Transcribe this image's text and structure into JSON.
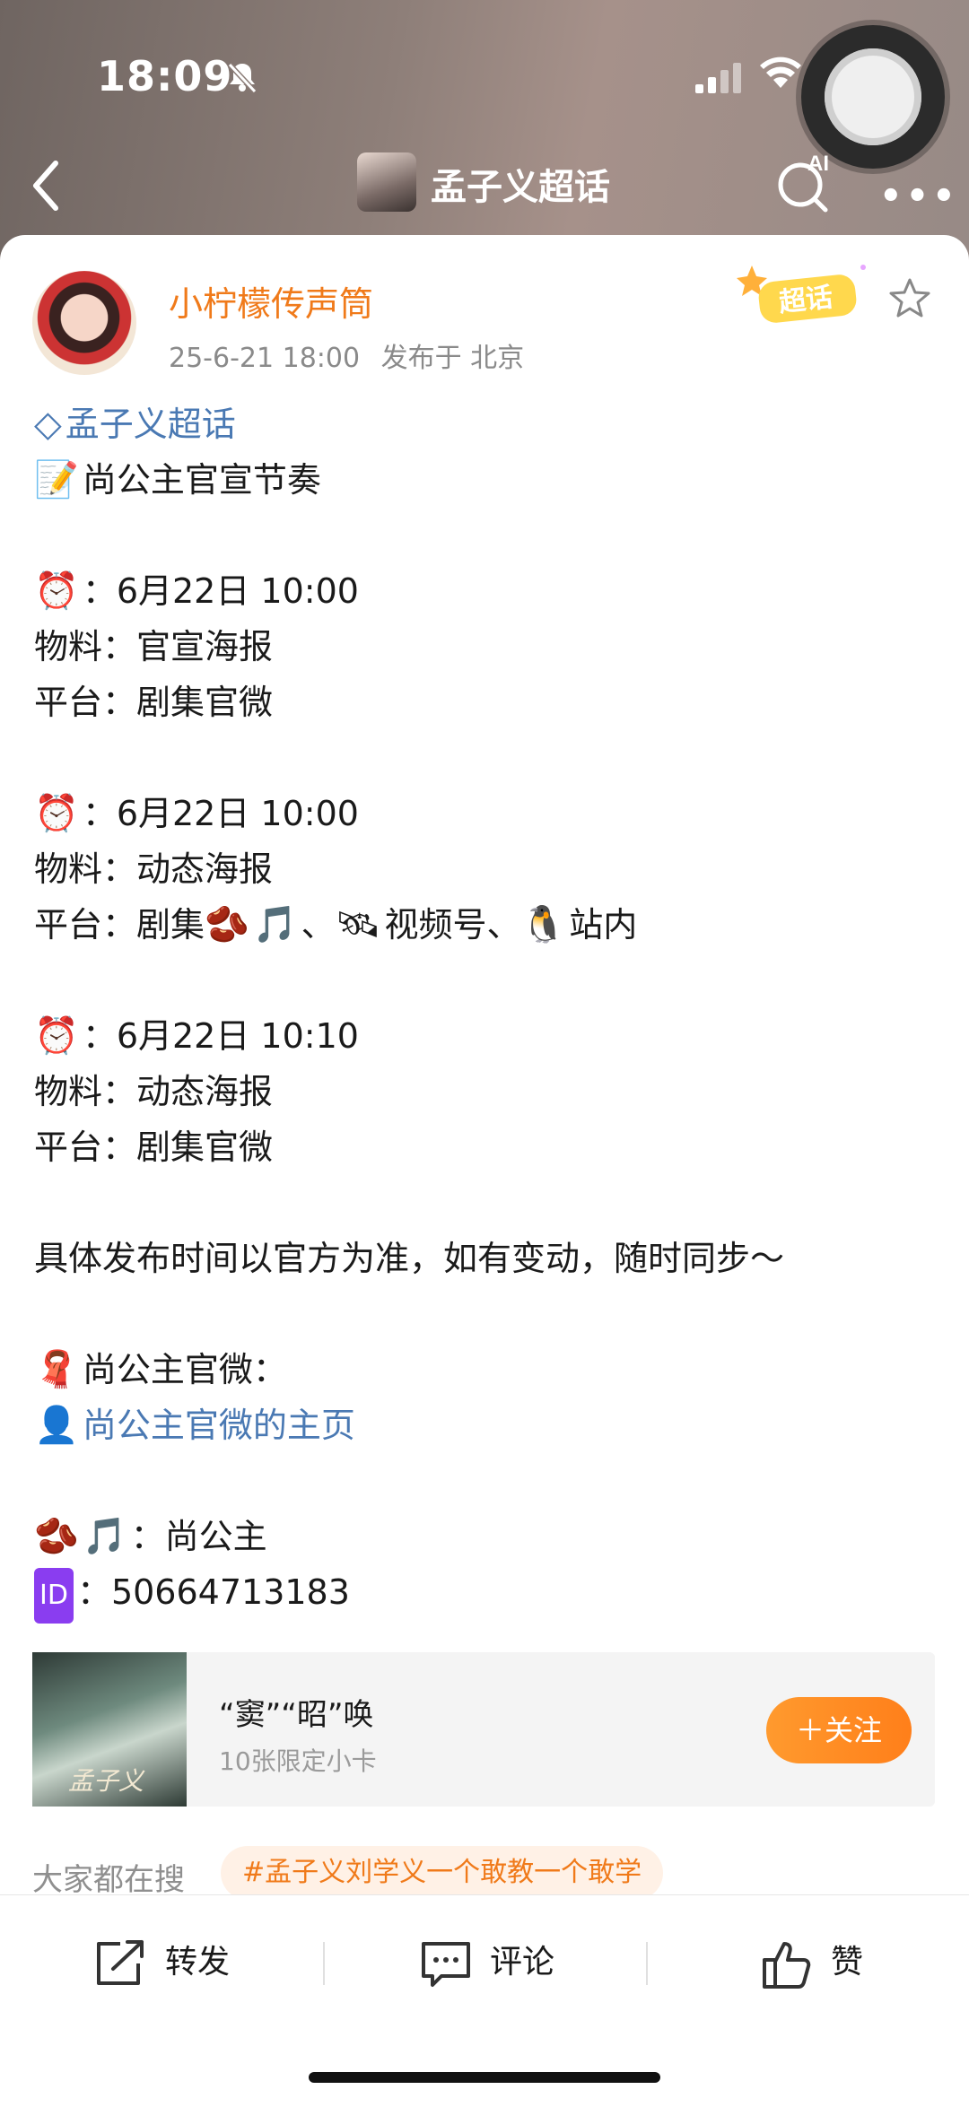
{
  "status_bar": {
    "time": "18:09"
  },
  "nav": {
    "title": "孟子义超话",
    "ai_label": "AI"
  },
  "post": {
    "author": "小柠檬传声筒",
    "date": "25-6-21 18:00",
    "location": "发布于 北京",
    "badge": "超话",
    "topic_link": "孟子义超话",
    "lines": {
      "l1": "尚公主官宣节奏",
      "t1": "：6月22日 10:00",
      "m1": "物料：官宣海报",
      "p1": "平台：剧集官微",
      "t2": "：6月22日 10:00",
      "m2": "物料：动态海报",
      "p2a": "平台：剧集",
      "p2b": "、",
      "p2c": "视频号、",
      "p2d": "站内",
      "t3": "：6月22日 10:10",
      "m3": "物料：动态海报",
      "p3": "平台：剧集官微",
      "note": "具体发布时间以官方为准，如有变动，随时同步～",
      "official": "尚公主官微：",
      "official_link": "尚公主官微的主页",
      "music": "：尚公主",
      "id": "：50664713183"
    }
  },
  "promo": {
    "title": "“窦”“昭”唤",
    "subtitle": "10张限定小卡",
    "follow": "＋关注",
    "thumb_text": "孟子义"
  },
  "trend": {
    "label": "大家都在搜",
    "tag": "#孟子义刘学义一个敢教一个敢学"
  },
  "actions": {
    "repost": "转发",
    "comment": "评论",
    "like": "赞"
  }
}
